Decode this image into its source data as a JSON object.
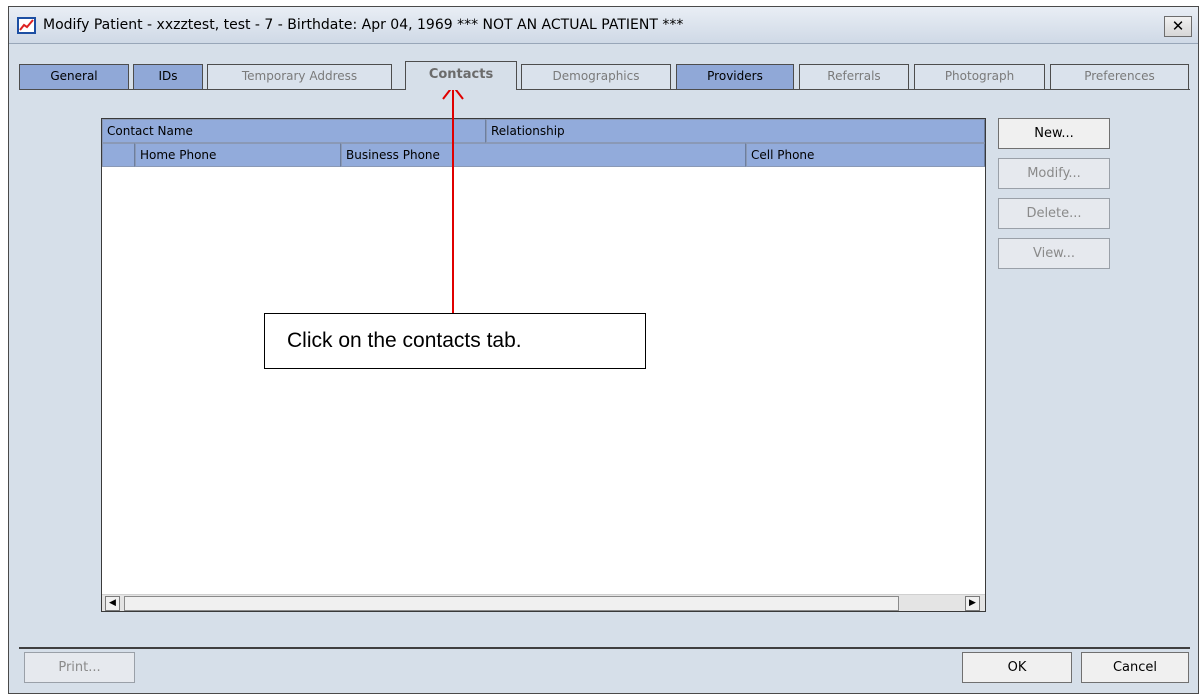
{
  "window": {
    "title": "Modify Patient - xxzztest, test  - 7 - Birthdate: Apr 04, 1969 *** NOT AN ACTUAL PATIENT ***",
    "close_label": "✕"
  },
  "tabs": [
    {
      "label": "General",
      "state": "enabled"
    },
    {
      "label": "IDs",
      "state": "enabled"
    },
    {
      "label": "Temporary Address",
      "state": "disabled"
    },
    {
      "label": "Contacts",
      "state": "selected"
    },
    {
      "label": "Demographics",
      "state": "disabled"
    },
    {
      "label": "Providers",
      "state": "enabled"
    },
    {
      "label": "Referrals",
      "state": "disabled"
    },
    {
      "label": "Photograph",
      "state": "disabled"
    },
    {
      "label": "Preferences",
      "state": "disabled"
    }
  ],
  "grid": {
    "headers_row1": [
      "Contact Name",
      "Relationship"
    ],
    "headers_row2": [
      "",
      "Home Phone",
      "Business Phone",
      "Cell Phone"
    ],
    "rows": [],
    "scroll_left": "◀",
    "scroll_right": "▶"
  },
  "side_buttons": [
    "New...",
    "Modify...",
    "Delete...",
    "View..."
  ],
  "footer": {
    "print_label": "Print...",
    "ok_label": "OK",
    "cancel_label": "Cancel"
  },
  "callout": {
    "text": "Click on the contacts tab."
  },
  "colors": {
    "header_blue": "#92abdb",
    "dialog_bg": "#d6dfe9",
    "arrow_red": "#e00000"
  },
  "icons": {
    "app": "chart-icon",
    "close": "close-icon"
  }
}
